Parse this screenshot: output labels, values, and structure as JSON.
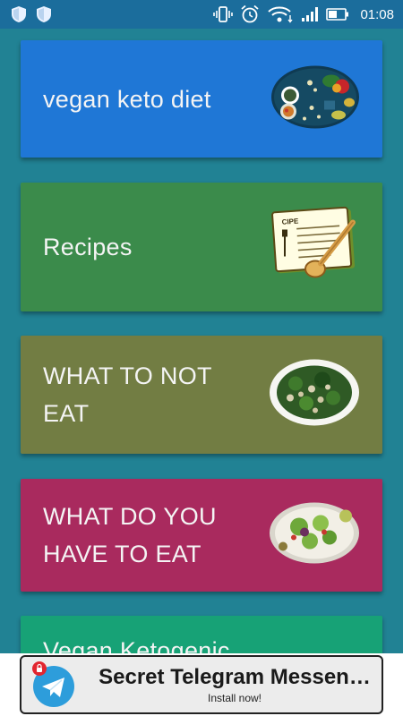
{
  "status_bar": {
    "time": "01:08",
    "left_icons": [
      "shield-icon",
      "shield-icon"
    ],
    "right_icons": [
      "vibrate-icon",
      "alarm-icon",
      "wifi-icon",
      "signal-icon",
      "battery-icon"
    ]
  },
  "cards": [
    {
      "title": "vegan keto diet",
      "color": "#1f77d6",
      "image": "vegetables-plate-image"
    },
    {
      "title": "Recipes",
      "color": "#3b8b4b",
      "image": "recipe-card-image"
    },
    {
      "title": "WHAT TO NOT EAT",
      "color": "#727d43",
      "image": "kale-salad-image"
    },
    {
      "title": "WHAT DO YOU HAVE TO EAT",
      "color": "#a92a5e",
      "image": "green-salad-image"
    },
    {
      "title": "Vegan Ketogenic",
      "color": "#17a276"
    }
  ],
  "ad": {
    "title": "Secret Telegram Messen…",
    "subtitle": "Install now!",
    "icon": "telegram-icon"
  }
}
